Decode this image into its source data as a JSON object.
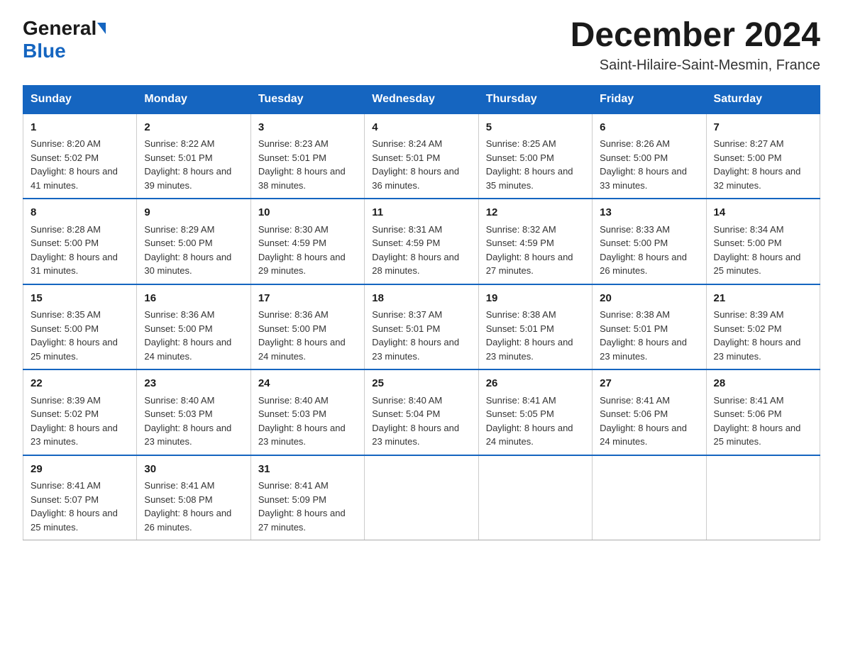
{
  "logo": {
    "general": "General",
    "blue": "Blue"
  },
  "header": {
    "month_year": "December 2024",
    "location": "Saint-Hilaire-Saint-Mesmin, France"
  },
  "calendar": {
    "days_of_week": [
      "Sunday",
      "Monday",
      "Tuesday",
      "Wednesday",
      "Thursday",
      "Friday",
      "Saturday"
    ],
    "weeks": [
      [
        {
          "day": "1",
          "sunrise": "8:20 AM",
          "sunset": "5:02 PM",
          "daylight": "8 hours and 41 minutes."
        },
        {
          "day": "2",
          "sunrise": "8:22 AM",
          "sunset": "5:01 PM",
          "daylight": "8 hours and 39 minutes."
        },
        {
          "day": "3",
          "sunrise": "8:23 AM",
          "sunset": "5:01 PM",
          "daylight": "8 hours and 38 minutes."
        },
        {
          "day": "4",
          "sunrise": "8:24 AM",
          "sunset": "5:01 PM",
          "daylight": "8 hours and 36 minutes."
        },
        {
          "day": "5",
          "sunrise": "8:25 AM",
          "sunset": "5:00 PM",
          "daylight": "8 hours and 35 minutes."
        },
        {
          "day": "6",
          "sunrise": "8:26 AM",
          "sunset": "5:00 PM",
          "daylight": "8 hours and 33 minutes."
        },
        {
          "day": "7",
          "sunrise": "8:27 AM",
          "sunset": "5:00 PM",
          "daylight": "8 hours and 32 minutes."
        }
      ],
      [
        {
          "day": "8",
          "sunrise": "8:28 AM",
          "sunset": "5:00 PM",
          "daylight": "8 hours and 31 minutes."
        },
        {
          "day": "9",
          "sunrise": "8:29 AM",
          "sunset": "5:00 PM",
          "daylight": "8 hours and 30 minutes."
        },
        {
          "day": "10",
          "sunrise": "8:30 AM",
          "sunset": "4:59 PM",
          "daylight": "8 hours and 29 minutes."
        },
        {
          "day": "11",
          "sunrise": "8:31 AM",
          "sunset": "4:59 PM",
          "daylight": "8 hours and 28 minutes."
        },
        {
          "day": "12",
          "sunrise": "8:32 AM",
          "sunset": "4:59 PM",
          "daylight": "8 hours and 27 minutes."
        },
        {
          "day": "13",
          "sunrise": "8:33 AM",
          "sunset": "5:00 PM",
          "daylight": "8 hours and 26 minutes."
        },
        {
          "day": "14",
          "sunrise": "8:34 AM",
          "sunset": "5:00 PM",
          "daylight": "8 hours and 25 minutes."
        }
      ],
      [
        {
          "day": "15",
          "sunrise": "8:35 AM",
          "sunset": "5:00 PM",
          "daylight": "8 hours and 25 minutes."
        },
        {
          "day": "16",
          "sunrise": "8:36 AM",
          "sunset": "5:00 PM",
          "daylight": "8 hours and 24 minutes."
        },
        {
          "day": "17",
          "sunrise": "8:36 AM",
          "sunset": "5:00 PM",
          "daylight": "8 hours and 24 minutes."
        },
        {
          "day": "18",
          "sunrise": "8:37 AM",
          "sunset": "5:01 PM",
          "daylight": "8 hours and 23 minutes."
        },
        {
          "day": "19",
          "sunrise": "8:38 AM",
          "sunset": "5:01 PM",
          "daylight": "8 hours and 23 minutes."
        },
        {
          "day": "20",
          "sunrise": "8:38 AM",
          "sunset": "5:01 PM",
          "daylight": "8 hours and 23 minutes."
        },
        {
          "day": "21",
          "sunrise": "8:39 AM",
          "sunset": "5:02 PM",
          "daylight": "8 hours and 23 minutes."
        }
      ],
      [
        {
          "day": "22",
          "sunrise": "8:39 AM",
          "sunset": "5:02 PM",
          "daylight": "8 hours and 23 minutes."
        },
        {
          "day": "23",
          "sunrise": "8:40 AM",
          "sunset": "5:03 PM",
          "daylight": "8 hours and 23 minutes."
        },
        {
          "day": "24",
          "sunrise": "8:40 AM",
          "sunset": "5:03 PM",
          "daylight": "8 hours and 23 minutes."
        },
        {
          "day": "25",
          "sunrise": "8:40 AM",
          "sunset": "5:04 PM",
          "daylight": "8 hours and 23 minutes."
        },
        {
          "day": "26",
          "sunrise": "8:41 AM",
          "sunset": "5:05 PM",
          "daylight": "8 hours and 24 minutes."
        },
        {
          "day": "27",
          "sunrise": "8:41 AM",
          "sunset": "5:06 PM",
          "daylight": "8 hours and 24 minutes."
        },
        {
          "day": "28",
          "sunrise": "8:41 AM",
          "sunset": "5:06 PM",
          "daylight": "8 hours and 25 minutes."
        }
      ],
      [
        {
          "day": "29",
          "sunrise": "8:41 AM",
          "sunset": "5:07 PM",
          "daylight": "8 hours and 25 minutes."
        },
        {
          "day": "30",
          "sunrise": "8:41 AM",
          "sunset": "5:08 PM",
          "daylight": "8 hours and 26 minutes."
        },
        {
          "day": "31",
          "sunrise": "8:41 AM",
          "sunset": "5:09 PM",
          "daylight": "8 hours and 27 minutes."
        },
        null,
        null,
        null,
        null
      ]
    ],
    "labels": {
      "sunrise": "Sunrise:",
      "sunset": "Sunset:",
      "daylight": "Daylight:"
    }
  }
}
